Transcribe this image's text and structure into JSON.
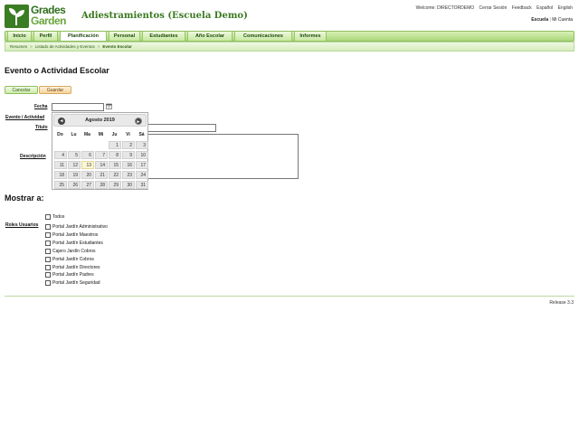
{
  "header": {
    "logo_line1": "Grades",
    "logo_line2": "Garden",
    "school_title": "Adiestramientos (Escuela Demo)",
    "welcome": "Welcome: DIRECTORDEMO",
    "links": [
      "Cerrar Sesión",
      "Feedback",
      "Español",
      "English"
    ],
    "school_label": "Escuela",
    "my_account": "Mi Cuenta"
  },
  "nav": {
    "tabs": [
      "Inicio",
      "Perfil",
      "Planificación",
      "Personal",
      "Estudiantes",
      "Año Escolar",
      "Comunicaciones",
      "Informes"
    ],
    "active": "Planificación"
  },
  "breadcrumb": {
    "items": [
      "Resumen",
      "Listado de Actividades y Eventos",
      "Evento Escolar"
    ]
  },
  "page": {
    "title": "Evento o Actividad Escolar",
    "cancel_label": "Cancelar",
    "save_label": "Guardar"
  },
  "form": {
    "fecha_label": "Fecha",
    "fecha_value": "",
    "tipo_label": "Evento / Actividad",
    "titulo_label": "Título",
    "titulo_value": "",
    "descripcion_label": "Descripción",
    "descripcion_value": ""
  },
  "datepicker": {
    "month_title": "Agosto 2019",
    "prev_icon": "◄",
    "next_icon": "►",
    "weekdays": [
      "Do",
      "Lu",
      "Ma",
      "Mi",
      "Ju",
      "Vi",
      "Sá"
    ],
    "first_weekday_index": 4,
    "days_in_month": 31,
    "today": 13
  },
  "show_to": {
    "title": "Mostrar a:",
    "roles_label": "Roles Usuarios",
    "all_label": "Todos",
    "roles": [
      "Portal Jardín Administrativo",
      "Portal Jardín Maestros",
      "Portal Jardín Estudiantes",
      "Cajero Jardín Cobros",
      "Portal Jardín Cobros",
      "Portal Jardín Directores",
      "Portal Jardín Padres",
      "Portal Jardín Seguridad"
    ]
  },
  "footer": {
    "release": "Release 3.3"
  },
  "colors": {
    "brand_green": "#3b7d23",
    "nav_green": "#a9d77a",
    "save_orange": "#f6d39a"
  }
}
